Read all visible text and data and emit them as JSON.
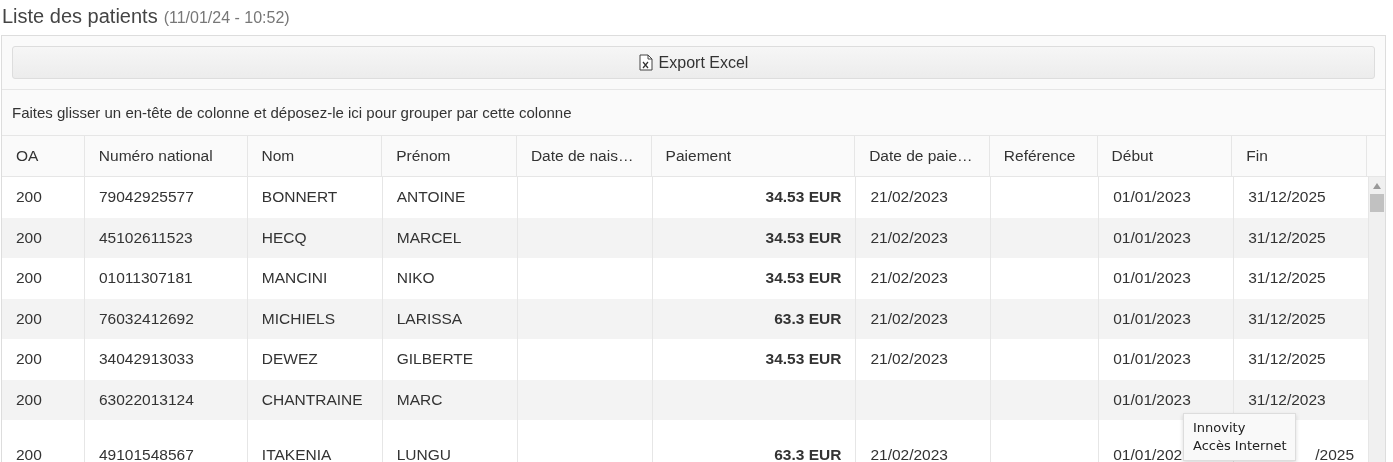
{
  "title": "Liste des patients",
  "timestamp": "(11/01/24 - 10:52)",
  "export_button": "Export Excel",
  "group_hint": "Faites glisser un en-tête de colonne et déposez-le ici pour grouper par cette colonne",
  "columns": [
    "OA",
    "Numéro national",
    "Nom",
    "Prénom",
    "Date de nais…",
    "Paiement",
    "Date de paie…",
    "Reférence",
    "Début",
    "Fin"
  ],
  "rows": [
    {
      "cells": [
        "200",
        "79042925577",
        "BONNERT",
        "ANTOINE",
        "",
        "34.53 EUR",
        "21/02/2023",
        "",
        "01/01/2023",
        "31/12/2025"
      ],
      "covered": false
    },
    {
      "cells": [
        "200",
        "45102611523",
        "HECQ",
        "MARCEL",
        "",
        "34.53 EUR",
        "21/02/2023",
        "",
        "01/01/2023",
        "31/12/2025"
      ],
      "covered": false
    },
    {
      "cells": [
        "200",
        "01011307181",
        "MANCINI",
        "NIKO",
        "",
        "34.53 EUR",
        "21/02/2023",
        "",
        "01/01/2023",
        "31/12/2025"
      ],
      "covered": false
    },
    {
      "cells": [
        "200",
        "76032412692",
        "MICHIELS",
        "LARISSA",
        "",
        "63.3 EUR",
        "21/02/2023",
        "",
        "01/01/2023",
        "31/12/2025"
      ],
      "covered": false
    },
    {
      "cells": [
        "200",
        "34042913033",
        "DEWEZ",
        "GILBERTE",
        "",
        "34.53 EUR",
        "21/02/2023",
        "",
        "01/01/2023",
        "31/12/2025"
      ],
      "covered": false
    },
    {
      "cells": [
        "200",
        "63022013124",
        "CHANTRAINE",
        "MARC",
        "",
        "",
        "",
        "",
        "01/01/2023",
        "31/12/2023"
      ],
      "covered": false
    },
    {
      "cells": [
        "200",
        "49101548567",
        "ITAKENIA",
        "LUNGU",
        "",
        "63.3 EUR",
        "21/02/2023",
        "",
        "01/01/202",
        "/2025"
      ],
      "covered": true
    }
  ],
  "tooltip": [
    "Innovity",
    "Accès Internet"
  ]
}
